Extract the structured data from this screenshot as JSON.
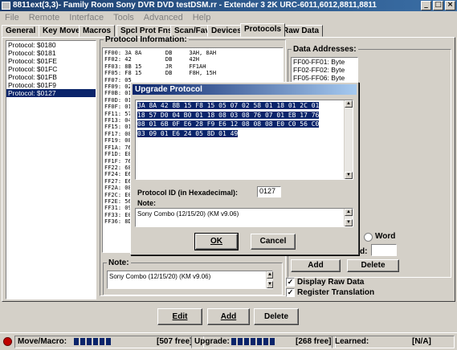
{
  "window": {
    "title": "8811ext(3,3)- Family Room Sony DVR DVD testDSM.rr - Extender 3 2K URC-6011,6012,8811,8811"
  },
  "menu": [
    "File",
    "Remote",
    "Interface",
    "Tools",
    "Advanced",
    "Help"
  ],
  "tabs": [
    {
      "label": "General"
    },
    {
      "label": "Key Moves"
    },
    {
      "label": "Macros"
    },
    {
      "label": "Spcl Prot Fns"
    },
    {
      "label": "Scan/Fav"
    },
    {
      "label": "Devices"
    },
    {
      "label": "Protocols",
      "active": true
    },
    {
      "label": "Raw Data"
    }
  ],
  "protocols": {
    "items": [
      "Protocol: $0180",
      "Protocol: $0181",
      "Protocol: $01FE",
      "Protocol: $01FC",
      "Protocol: $01FB",
      "Protocol: $01F9",
      "Protocol: $0127"
    ],
    "selected": "Protocol: $0127"
  },
  "info": {
    "legend": "Protocol Information:",
    "lines": [
      "FF00: 3A 8A       DB     3AH, 8AH",
      "FF02: 42          DB     42H",
      "FF03: 8B 15       JR     FF1AH",
      "FF05: F8 15       DB     F8H, 15H",
      "FF07: 05",
      "FF09: 02",
      "FF0B: 01",
      "FF0D: 01",
      "FF0F: 01",
      "FF11: 57",
      "FF13: 04",
      "FF15: 01",
      "FF17: 08",
      "FF19: 08",
      "FF1A: 76",
      "FF1D: E8",
      "FF1F: 76",
      "FF22: 68",
      "FF24: E6",
      "FF27: E6",
      "FF2A: 08",
      "FF2C: E0",
      "FF2E: 56",
      "FF31: 09",
      "FF33: E0",
      "FF36: 8D"
    ]
  },
  "data_addresses": {
    "legend": "Data Addresses:",
    "items": [
      "FF00-FF01: Byte",
      "FF02-FF02: Byte",
      "FF05-FF06: Byte"
    ],
    "word_label": "Word",
    "d_label": "d:"
  },
  "note_box": {
    "legend": "Note:",
    "text": "Sony Combo (12/15/20) (KM v9.06)"
  },
  "right_buttons": {
    "add": "Add",
    "delete": "Delete"
  },
  "checks": {
    "display_raw": "Display Raw Data",
    "register": "Register Translation"
  },
  "bottom_buttons": {
    "edit": "Edit",
    "add": "Add",
    "delete": "Delete"
  },
  "dialog": {
    "title": "Upgrade Protocol",
    "hex": [
      "3A 8A 42 8B 15 F8 15 05 07 02 58 01 18 01 2C 01",
      "18 57 D0 04 B0 01 18 08 03 08 76 07 01 EB 17 76",
      "08 01 6B 0F E6 28 F9 E6 12 08 08 08 E0 C0 56 C0",
      "03 09 01 E6 24 05 8D 01 49"
    ],
    "pid_label": "Protocol ID (in Hexadecimal):",
    "pid_value": "0127",
    "note_label": "Note:",
    "note_value": "Sony Combo (12/15/20) (KM v9.06)",
    "ok": "OK",
    "cancel": "Cancel"
  },
  "status": {
    "move_label": "Move/Macro:",
    "move_free": "[507 free]",
    "upgrade_label": "Upgrade:",
    "upgrade_free": "[268 free]",
    "learned_label": "Learned:",
    "learned_value": "[N/A]",
    "move_fill": 0.3,
    "upgrade_fill": 0.35
  },
  "colors": {
    "selection": "#0a246a",
    "face": "#d4d0c8"
  }
}
